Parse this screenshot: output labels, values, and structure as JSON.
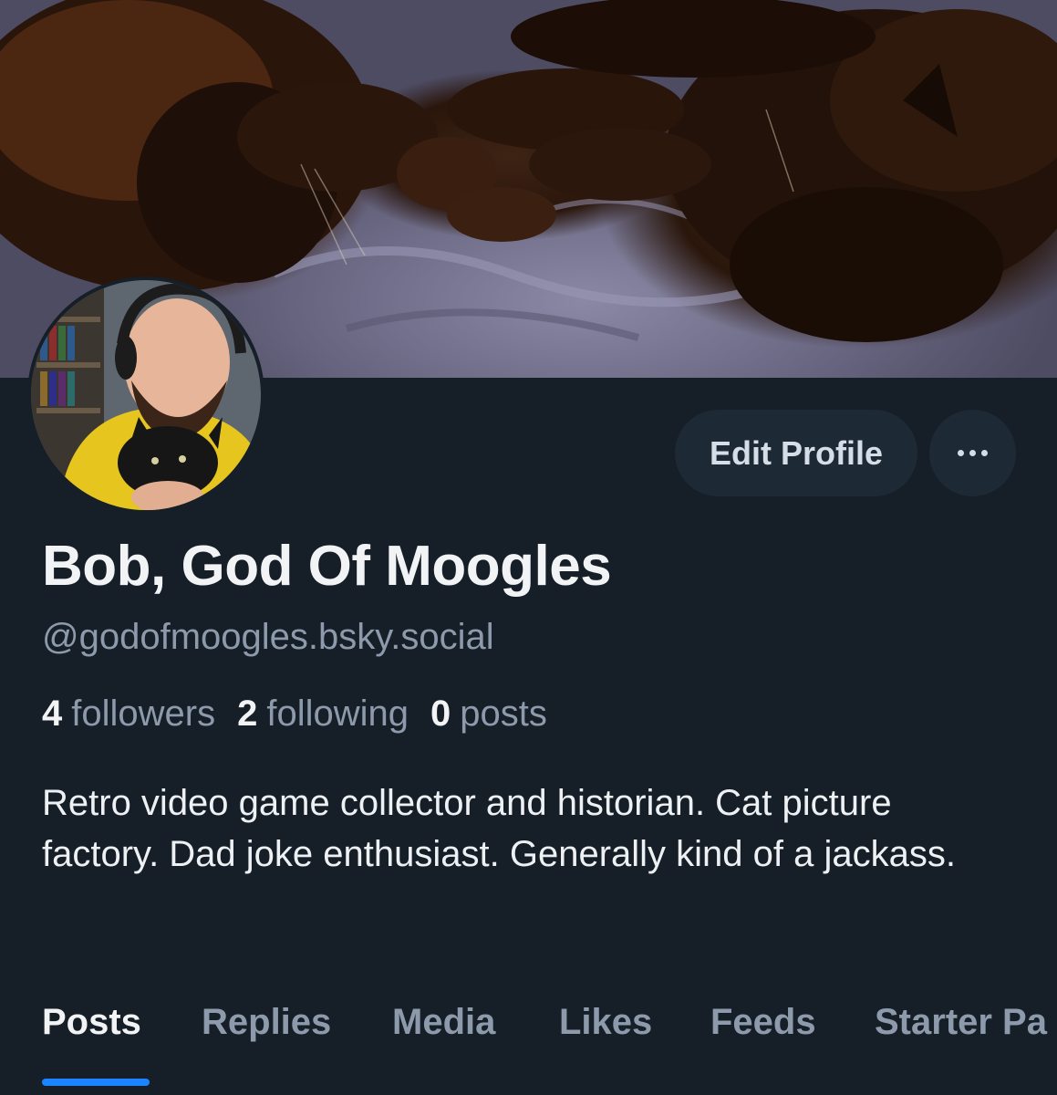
{
  "profile": {
    "display_name": "Bob, God Of Moogles",
    "handle": "@godofmoogles.bsky.social",
    "bio": "Retro video game collector and historian. Cat picture factory. Dad joke enthusiast. Generally kind of a jackass."
  },
  "stats": {
    "followers_count": "4",
    "followers_label": "followers",
    "following_count": "2",
    "following_label": "following",
    "posts_count": "0",
    "posts_label": "posts"
  },
  "actions": {
    "edit_profile_label": "Edit Profile"
  },
  "tabs": [
    {
      "label": "Posts",
      "active": true
    },
    {
      "label": "Replies",
      "active": false
    },
    {
      "label": "Media",
      "active": false
    },
    {
      "label": "Likes",
      "active": false
    },
    {
      "label": "Feeds",
      "active": false
    },
    {
      "label": "Starter Pa",
      "active": false
    }
  ],
  "icons": {
    "more": "more-horizontal-icon"
  },
  "colors": {
    "background": "#161e27",
    "button_bg": "#1e2936",
    "accent": "#1a85ff",
    "text_primary": "#f1f3f5",
    "text_secondary": "#8d9aab"
  }
}
